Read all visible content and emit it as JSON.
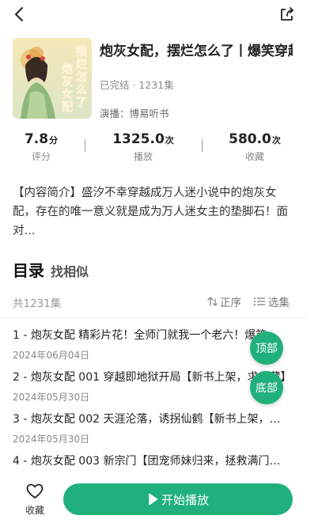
{
  "header": {
    "back_icon": "back-chevron-icon",
    "share_icon": "share-icon"
  },
  "book": {
    "title": "炮灰女配，摆烂怎么了丨爆笑穿越",
    "status": "已完结 · 1231集",
    "narrator_prefix": "演播：",
    "narrator": "博易听书",
    "cover_text": "摆烂怎么了 炮灰女配"
  },
  "stats": [
    {
      "value": "7.8",
      "unit": "分",
      "label": "评分"
    },
    {
      "value": "1325.0",
      "unit": "次",
      "label": "播放"
    },
    {
      "value": "580.0",
      "unit": "次",
      "label": "收藏"
    }
  ],
  "intro": "【内容简介】盛汐不幸穿越成万人迷小说中的炮灰女配，存在的唯一意义就是成为万人迷女主的垫脚石！面对...",
  "catalog": {
    "title": "目录",
    "similar": "找相似",
    "count": "共1231集",
    "sort_label": "正序",
    "select_label": "选集"
  },
  "episodes": [
    {
      "title": "1 - 炮灰女配 精彩片花！全师门就我一个老六！爆笑…",
      "date": "2024年06月04日"
    },
    {
      "title": "2 - 炮灰女配 001 穿越即地狱开局【新书上架，求收藏】",
      "date": "2024年05月30日"
    },
    {
      "title": "3 - 炮灰女配 002 天涯沦落，诱拐仙鹤【新书上架，…",
      "date": "2024年05月30日"
    },
    {
      "title": "4 - 炮灰女配 003 新宗门【团宠师妹归来，拯救满门…",
      "date": ""
    }
  ],
  "float_buttons": {
    "top": "顶部",
    "bottom": "底部"
  },
  "bottom": {
    "fav_label": "收藏",
    "play_label": "开始播放"
  },
  "colors": {
    "accent": "#1fb07b"
  }
}
